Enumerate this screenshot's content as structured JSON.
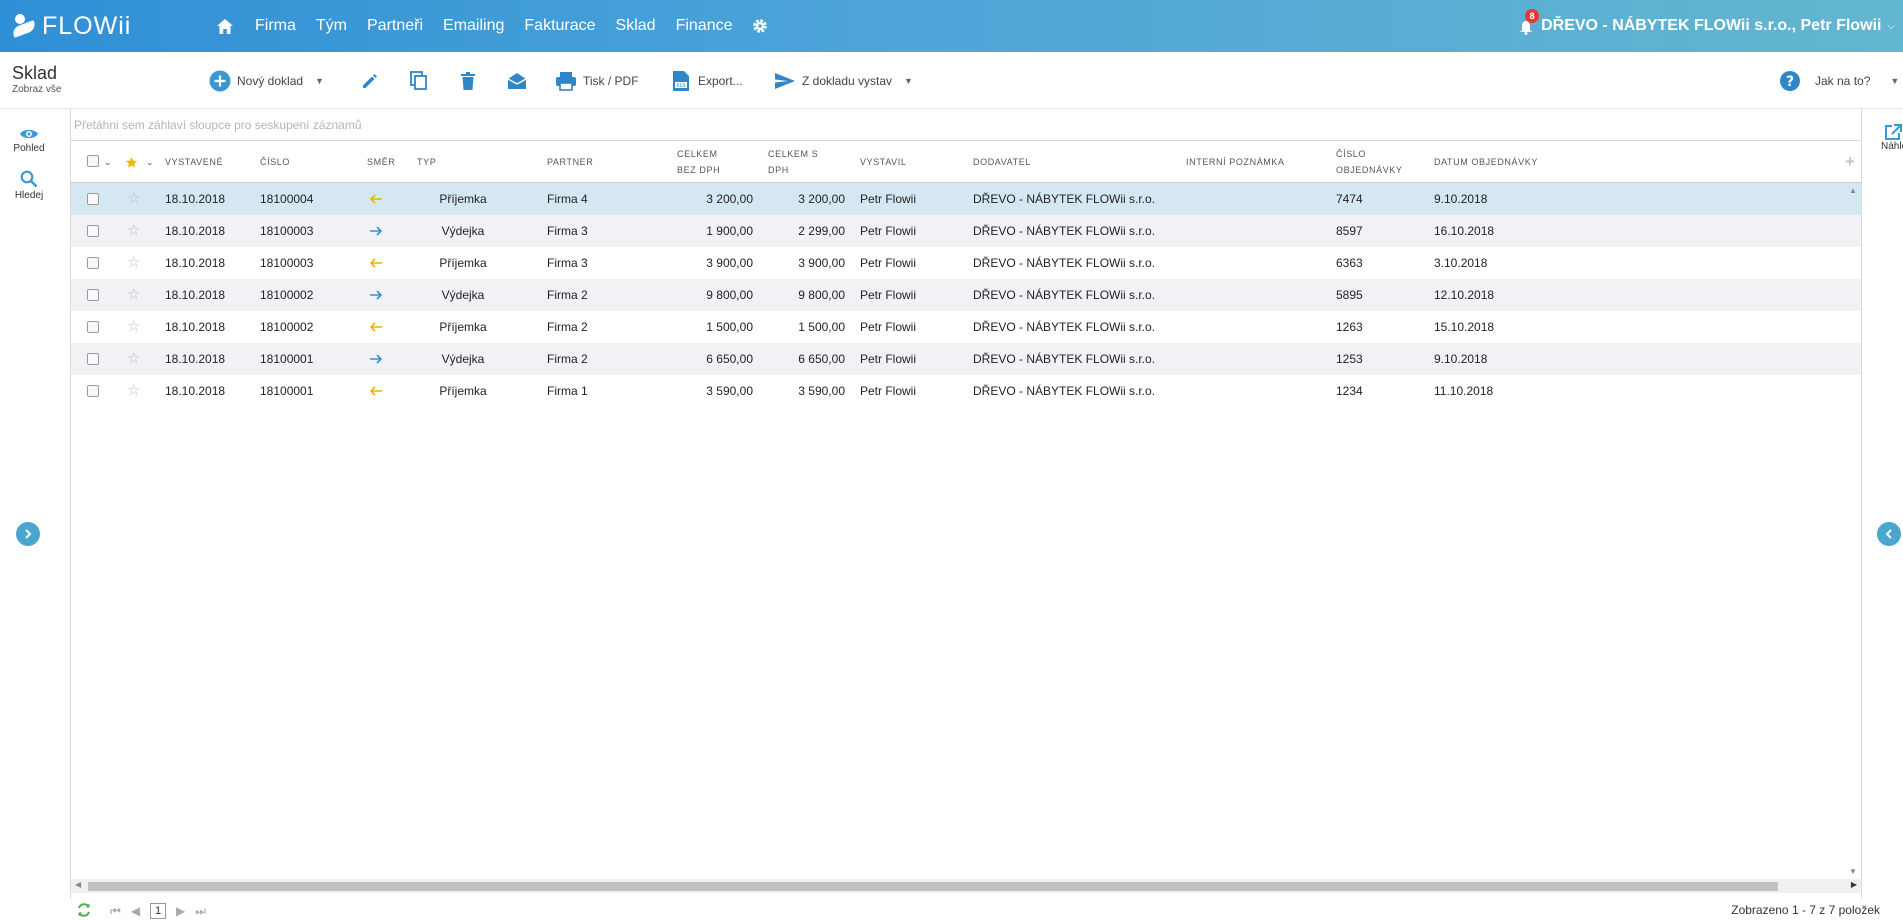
{
  "app": {
    "logo_text": "FLOWii",
    "brand_color": "#3a9ad8",
    "nav": [
      "Firma",
      "Tým",
      "Partneři",
      "Emailing",
      "Fakturace",
      "Sklad",
      "Finance"
    ],
    "notification_count": "8",
    "company": "DŘEVO - NÁBYTEK FLOWii s.r.o., Petr Flowii"
  },
  "toolbar": {
    "title": "Sklad",
    "subtitle": "Zobraz vše",
    "new_doc": "Nový doklad",
    "print": "Tisk / PDF",
    "export": "Export...",
    "from_doc": "Z dokladu vystav",
    "help": "Jak na to?"
  },
  "sidebar": {
    "view": "Pohled",
    "search": "Hledej"
  },
  "right": {
    "preview": "Náhled"
  },
  "grid": {
    "group_hint": "Přetáhni sem záhlaví sloupce pro seskupení záznamů",
    "headers": {
      "vystavene": "Vystavené",
      "cislo": "Číslo",
      "smer": "Směr",
      "typ": "Typ",
      "partner": "Partner",
      "celkem_bez_1": "Celkem",
      "celkem_bez_2": "bez DPH",
      "celkem_s_1": "Celkem s",
      "celkem_s_2": "DPH",
      "vystavil": "Vystavil",
      "dodavatel": "Dodavatel",
      "poznamka": "Interní poznámka",
      "objednavka_1": "Číslo",
      "objednavka_2": "objednávky",
      "datum_obj": "Datum objednávky"
    },
    "rows": [
      {
        "vystavene": "18.10.2018",
        "cislo": "18100004",
        "smer": "in",
        "typ": "Příjemka",
        "partner": "Firma 4",
        "bez": "3 200,00",
        "s": "3 200,00",
        "vystavil": "Petr Flowii",
        "dodavatel": "DŘEVO - NÁBYTEK FLOWii s.r.o.",
        "objednavka": "7474",
        "datum": "9.10.2018"
      },
      {
        "vystavene": "18.10.2018",
        "cislo": "18100003",
        "smer": "out",
        "typ": "Výdejka",
        "partner": "Firma 3",
        "bez": "1 900,00",
        "s": "2 299,00",
        "vystavil": "Petr Flowii",
        "dodavatel": "DŘEVO - NÁBYTEK FLOWii s.r.o.",
        "objednavka": "8597",
        "datum": "16.10.2018"
      },
      {
        "vystavene": "18.10.2018",
        "cislo": "18100003",
        "smer": "in",
        "typ": "Příjemka",
        "partner": "Firma 3",
        "bez": "3 900,00",
        "s": "3 900,00",
        "vystavil": "Petr Flowii",
        "dodavatel": "DŘEVO - NÁBYTEK FLOWii s.r.o.",
        "objednavka": "6363",
        "datum": "3.10.2018"
      },
      {
        "vystavene": "18.10.2018",
        "cislo": "18100002",
        "smer": "out",
        "typ": "Výdejka",
        "partner": "Firma 2",
        "bez": "9 800,00",
        "s": "9 800,00",
        "vystavil": "Petr Flowii",
        "dodavatel": "DŘEVO - NÁBYTEK FLOWii s.r.o.",
        "objednavka": "5895",
        "datum": "12.10.2018"
      },
      {
        "vystavene": "18.10.2018",
        "cislo": "18100002",
        "smer": "in",
        "typ": "Příjemka",
        "partner": "Firma 2",
        "bez": "1 500,00",
        "s": "1 500,00",
        "vystavil": "Petr Flowii",
        "dodavatel": "DŘEVO - NÁBYTEK FLOWii s.r.o.",
        "objednavka": "1263",
        "datum": "15.10.2018"
      },
      {
        "vystavene": "18.10.2018",
        "cislo": "18100001",
        "smer": "out",
        "typ": "Výdejka",
        "partner": "Firma 2",
        "bez": "6 650,00",
        "s": "6 650,00",
        "vystavil": "Petr Flowii",
        "dodavatel": "DŘEVO - NÁBYTEK FLOWii s.r.o.",
        "objednavka": "1253",
        "datum": "9.10.2018"
      },
      {
        "vystavene": "18.10.2018",
        "cislo": "18100001",
        "smer": "in",
        "typ": "Příjemka",
        "partner": "Firma 1",
        "bez": "3 590,00",
        "s": "3 590,00",
        "vystavil": "Petr Flowii",
        "dodavatel": "DŘEVO - NÁBYTEK FLOWii s.r.o.",
        "objednavka": "1234",
        "datum": "11.10.2018"
      }
    ],
    "direction_colors": {
      "in": "#f0b400",
      "out": "#3a8fd6"
    }
  },
  "pager": {
    "page": "1",
    "summary": "Zobrazeno 1 - 7 z 7 položek"
  }
}
